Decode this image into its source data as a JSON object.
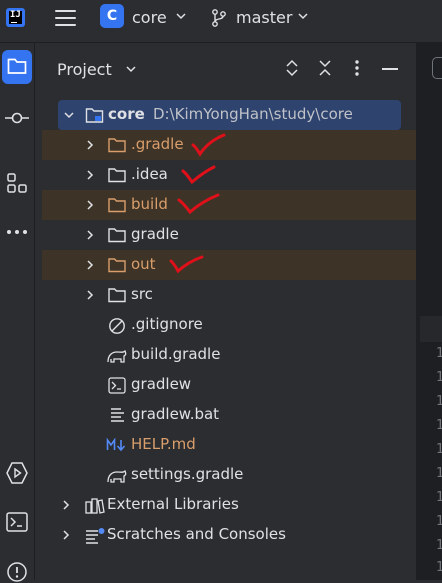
{
  "header": {
    "project_badge": "C",
    "project_name": "core",
    "branch_name": "master"
  },
  "panel": {
    "title": "Project"
  },
  "tree": {
    "root": {
      "name": "core",
      "path": "D:\\KimYongHan\\study\\core"
    },
    "items": [
      {
        "label": ".gradle",
        "kind": "folder",
        "excluded": true
      },
      {
        "label": ".idea",
        "kind": "folder",
        "excluded": false
      },
      {
        "label": "build",
        "kind": "folder",
        "excluded": true
      },
      {
        "label": "gradle",
        "kind": "folder",
        "excluded": false
      },
      {
        "label": "out",
        "kind": "folder",
        "excluded": true
      },
      {
        "label": "src",
        "kind": "folder",
        "excluded": false
      },
      {
        "label": ".gitignore",
        "kind": "gitignore"
      },
      {
        "label": "build.gradle",
        "kind": "gradle"
      },
      {
        "label": "gradlew",
        "kind": "terminal"
      },
      {
        "label": "gradlew.bat",
        "kind": "text"
      },
      {
        "label": "HELP.md",
        "kind": "markdown"
      },
      {
        "label": "settings.gradle",
        "kind": "gradle"
      }
    ],
    "external_libraries": "External Libraries",
    "scratches": "Scratches and Consoles"
  },
  "gutter_numbers": [
    "1",
    "1",
    "1",
    "1",
    "1",
    "1",
    "1",
    "1",
    "1",
    "1"
  ],
  "colors": {
    "accent": "#3574f0",
    "excluded_folder": "#d99e6b",
    "highlight_row": "#3d3326",
    "selected_row": "#2e436e",
    "annotation": "#e0101a"
  }
}
